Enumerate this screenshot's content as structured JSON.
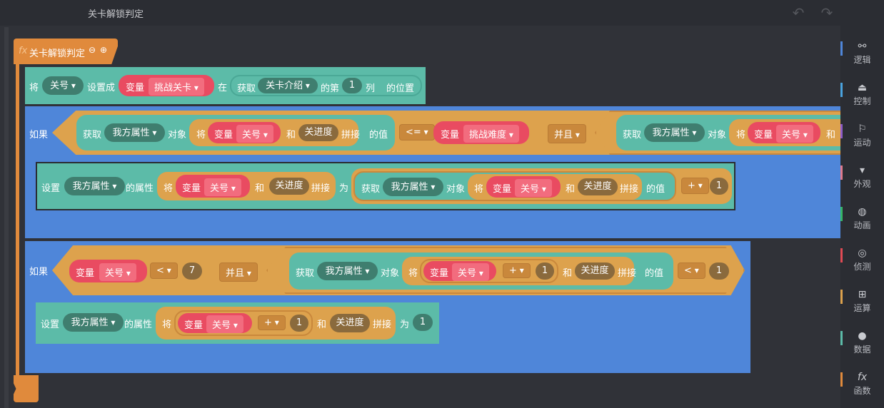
{
  "header": {
    "title": "关卡解锁判定",
    "undo_icon": "undo-icon",
    "redo_icon": "redo-icon"
  },
  "function": {
    "fx": "fx",
    "name": "关卡解锁判定"
  },
  "set_level_block": {
    "set_word": "将",
    "var_name": "关号",
    "set_to": "设置成",
    "var_label": "变量",
    "var_value": "挑战关卡",
    "at": "在",
    "get_word": "获取",
    "get_target": "关卡介绍",
    "the_nth": "的第",
    "column_num": "1",
    "column_word": "列",
    "position": "的位置"
  },
  "if_block_1": {
    "if_word": "如果",
    "get_word": "获取",
    "obj": "我方属性",
    "obj_word": "对象",
    "set_word": "将",
    "var_label": "变量",
    "var_name": "关号",
    "and_word": "和",
    "progress": "关进度",
    "concat": "拼接",
    "value_of": "的值",
    "op": "<=",
    "var2_name": "挑战难度",
    "logic": "并且"
  },
  "set_attr_block_1": {
    "set_word": "设置",
    "obj": "我方属性",
    "attr_word": "的属性",
    "set_word2": "将",
    "var_label": "变量",
    "var_name": "关号",
    "and_word": "和",
    "progress": "关进度",
    "concat": "拼接",
    "as_word": "为",
    "get_word": "获取",
    "obj_word": "对象",
    "value_of": "的值",
    "op": "+",
    "num": "1"
  },
  "if_block_2": {
    "if_word": "如果",
    "var_label": "变量",
    "var_name": "关号",
    "op": "<",
    "num": "7",
    "logic": "并且",
    "get_word": "获取",
    "obj": "我方属性",
    "obj_word": "对象",
    "set_word": "将",
    "plus_op": "+",
    "plus_num": "1",
    "and_word": "和",
    "progress": "关进度",
    "concat": "拼接",
    "value_of": "的值",
    "op2": "<",
    "num2": "1"
  },
  "set_attr_block_2": {
    "set_word": "设置",
    "obj": "我方属性",
    "attr_word": "的属性",
    "set_word2": "将",
    "var_label": "变量",
    "var_name": "关号",
    "plus_op": "+",
    "plus_num": "1",
    "and_word": "和",
    "progress": "关进度",
    "concat": "拼接",
    "as_word": "为",
    "num": "1"
  },
  "sidebar": {
    "items": [
      {
        "label": "逻辑",
        "icon": "logic-icon",
        "color": "#4f86d9"
      },
      {
        "label": "控制",
        "icon": "control-icon",
        "color": "#4aa3df"
      },
      {
        "label": "运动",
        "icon": "motion-icon",
        "color": "#8e5cc7"
      },
      {
        "label": "外观",
        "icon": "looks-icon",
        "color": "#e07a8c"
      },
      {
        "label": "动画",
        "icon": "animation-icon",
        "color": "#35b567"
      },
      {
        "label": "侦测",
        "icon": "sensing-icon",
        "color": "#e04a54"
      },
      {
        "label": "运算",
        "icon": "operators-icon",
        "color": "#dda24d"
      },
      {
        "label": "数据",
        "icon": "data-icon",
        "color": "#5cbba8"
      },
      {
        "label": "函数",
        "icon": "function-icon",
        "color": "#e08a3c"
      }
    ]
  }
}
